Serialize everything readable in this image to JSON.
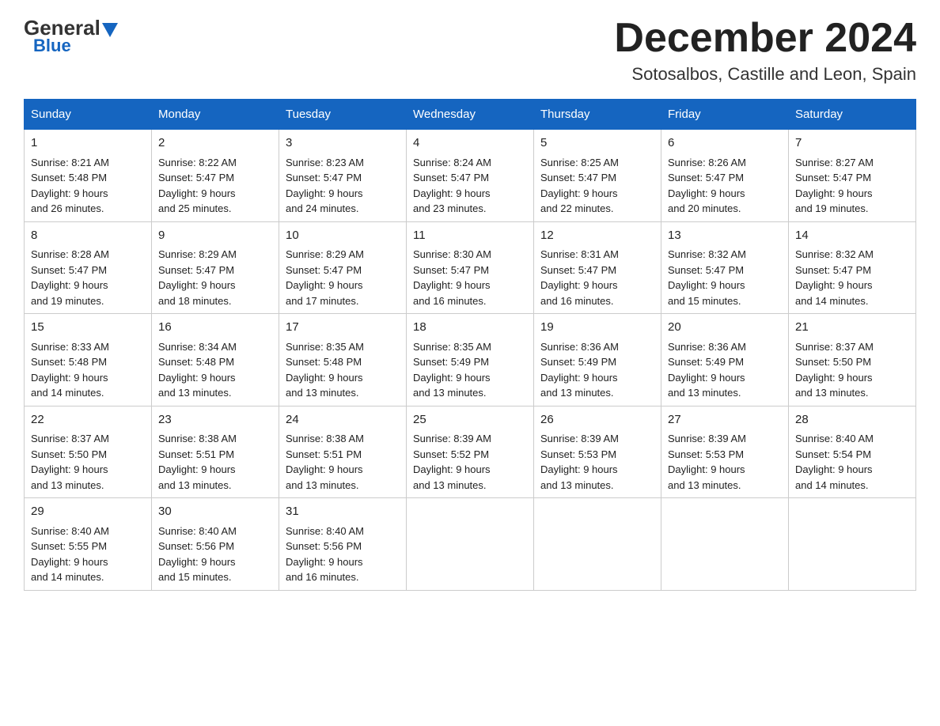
{
  "header": {
    "logo_general": "General",
    "logo_blue": "Blue",
    "month_title": "December 2024",
    "location": "Sotosalbos, Castille and Leon, Spain"
  },
  "weekdays": [
    "Sunday",
    "Monday",
    "Tuesday",
    "Wednesday",
    "Thursday",
    "Friday",
    "Saturday"
  ],
  "weeks": [
    [
      {
        "day": "1",
        "sunrise": "8:21 AM",
        "sunset": "5:48 PM",
        "daylight": "9 hours and 26 minutes."
      },
      {
        "day": "2",
        "sunrise": "8:22 AM",
        "sunset": "5:47 PM",
        "daylight": "9 hours and 25 minutes."
      },
      {
        "day": "3",
        "sunrise": "8:23 AM",
        "sunset": "5:47 PM",
        "daylight": "9 hours and 24 minutes."
      },
      {
        "day": "4",
        "sunrise": "8:24 AM",
        "sunset": "5:47 PM",
        "daylight": "9 hours and 23 minutes."
      },
      {
        "day": "5",
        "sunrise": "8:25 AM",
        "sunset": "5:47 PM",
        "daylight": "9 hours and 22 minutes."
      },
      {
        "day": "6",
        "sunrise": "8:26 AM",
        "sunset": "5:47 PM",
        "daylight": "9 hours and 20 minutes."
      },
      {
        "day": "7",
        "sunrise": "8:27 AM",
        "sunset": "5:47 PM",
        "daylight": "9 hours and 19 minutes."
      }
    ],
    [
      {
        "day": "8",
        "sunrise": "8:28 AM",
        "sunset": "5:47 PM",
        "daylight": "9 hours and 19 minutes."
      },
      {
        "day": "9",
        "sunrise": "8:29 AM",
        "sunset": "5:47 PM",
        "daylight": "9 hours and 18 minutes."
      },
      {
        "day": "10",
        "sunrise": "8:29 AM",
        "sunset": "5:47 PM",
        "daylight": "9 hours and 17 minutes."
      },
      {
        "day": "11",
        "sunrise": "8:30 AM",
        "sunset": "5:47 PM",
        "daylight": "9 hours and 16 minutes."
      },
      {
        "day": "12",
        "sunrise": "8:31 AM",
        "sunset": "5:47 PM",
        "daylight": "9 hours and 16 minutes."
      },
      {
        "day": "13",
        "sunrise": "8:32 AM",
        "sunset": "5:47 PM",
        "daylight": "9 hours and 15 minutes."
      },
      {
        "day": "14",
        "sunrise": "8:32 AM",
        "sunset": "5:47 PM",
        "daylight": "9 hours and 14 minutes."
      }
    ],
    [
      {
        "day": "15",
        "sunrise": "8:33 AM",
        "sunset": "5:48 PM",
        "daylight": "9 hours and 14 minutes."
      },
      {
        "day": "16",
        "sunrise": "8:34 AM",
        "sunset": "5:48 PM",
        "daylight": "9 hours and 13 minutes."
      },
      {
        "day": "17",
        "sunrise": "8:35 AM",
        "sunset": "5:48 PM",
        "daylight": "9 hours and 13 minutes."
      },
      {
        "day": "18",
        "sunrise": "8:35 AM",
        "sunset": "5:49 PM",
        "daylight": "9 hours and 13 minutes."
      },
      {
        "day": "19",
        "sunrise": "8:36 AM",
        "sunset": "5:49 PM",
        "daylight": "9 hours and 13 minutes."
      },
      {
        "day": "20",
        "sunrise": "8:36 AM",
        "sunset": "5:49 PM",
        "daylight": "9 hours and 13 minutes."
      },
      {
        "day": "21",
        "sunrise": "8:37 AM",
        "sunset": "5:50 PM",
        "daylight": "9 hours and 13 minutes."
      }
    ],
    [
      {
        "day": "22",
        "sunrise": "8:37 AM",
        "sunset": "5:50 PM",
        "daylight": "9 hours and 13 minutes."
      },
      {
        "day": "23",
        "sunrise": "8:38 AM",
        "sunset": "5:51 PM",
        "daylight": "9 hours and 13 minutes."
      },
      {
        "day": "24",
        "sunrise": "8:38 AM",
        "sunset": "5:51 PM",
        "daylight": "9 hours and 13 minutes."
      },
      {
        "day": "25",
        "sunrise": "8:39 AM",
        "sunset": "5:52 PM",
        "daylight": "9 hours and 13 minutes."
      },
      {
        "day": "26",
        "sunrise": "8:39 AM",
        "sunset": "5:53 PM",
        "daylight": "9 hours and 13 minutes."
      },
      {
        "day": "27",
        "sunrise": "8:39 AM",
        "sunset": "5:53 PM",
        "daylight": "9 hours and 13 minutes."
      },
      {
        "day": "28",
        "sunrise": "8:40 AM",
        "sunset": "5:54 PM",
        "daylight": "9 hours and 14 minutes."
      }
    ],
    [
      {
        "day": "29",
        "sunrise": "8:40 AM",
        "sunset": "5:55 PM",
        "daylight": "9 hours and 14 minutes."
      },
      {
        "day": "30",
        "sunrise": "8:40 AM",
        "sunset": "5:56 PM",
        "daylight": "9 hours and 15 minutes."
      },
      {
        "day": "31",
        "sunrise": "8:40 AM",
        "sunset": "5:56 PM",
        "daylight": "9 hours and 16 minutes."
      },
      null,
      null,
      null,
      null
    ]
  ],
  "labels": {
    "sunrise": "Sunrise:",
    "sunset": "Sunset:",
    "daylight": "Daylight:"
  }
}
